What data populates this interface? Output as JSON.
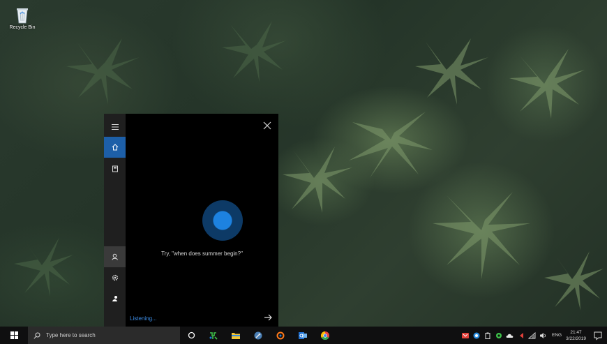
{
  "desktop": {
    "icons": [
      {
        "label": "Recycle Bin",
        "icon": "recycle-bin-icon"
      }
    ]
  },
  "cortana": {
    "rail": [
      {
        "name": "menu",
        "icon": "hamburger-menu-icon"
      },
      {
        "name": "home",
        "icon": "home-icon",
        "active": true
      },
      {
        "name": "notebook",
        "icon": "notebook-icon"
      },
      {
        "name": "account",
        "icon": "person-icon"
      },
      {
        "name": "settings",
        "icon": "gear-icon"
      },
      {
        "name": "feedback",
        "icon": "feedback-icon"
      }
    ],
    "prompt": "Try, \"when does summer begin?\"",
    "status": "Listening...",
    "accent_color": "#1d82e0"
  },
  "taskbar": {
    "search_placeholder": "Type here to search",
    "pinned": [
      {
        "name": "cortana",
        "icon": "circle-icon"
      },
      {
        "name": "app-green",
        "icon": "green-app-icon"
      },
      {
        "name": "file-explorer",
        "icon": "folder-icon"
      },
      {
        "name": "app-wrench",
        "icon": "tool-icon"
      },
      {
        "name": "app-orange",
        "icon": "orange-app-icon"
      },
      {
        "name": "outlook",
        "icon": "mail-icon"
      },
      {
        "name": "chrome",
        "icon": "chrome-icon"
      }
    ],
    "tray": {
      "language": "ENG",
      "time": "21:47",
      "date": "3/22/2019"
    }
  }
}
